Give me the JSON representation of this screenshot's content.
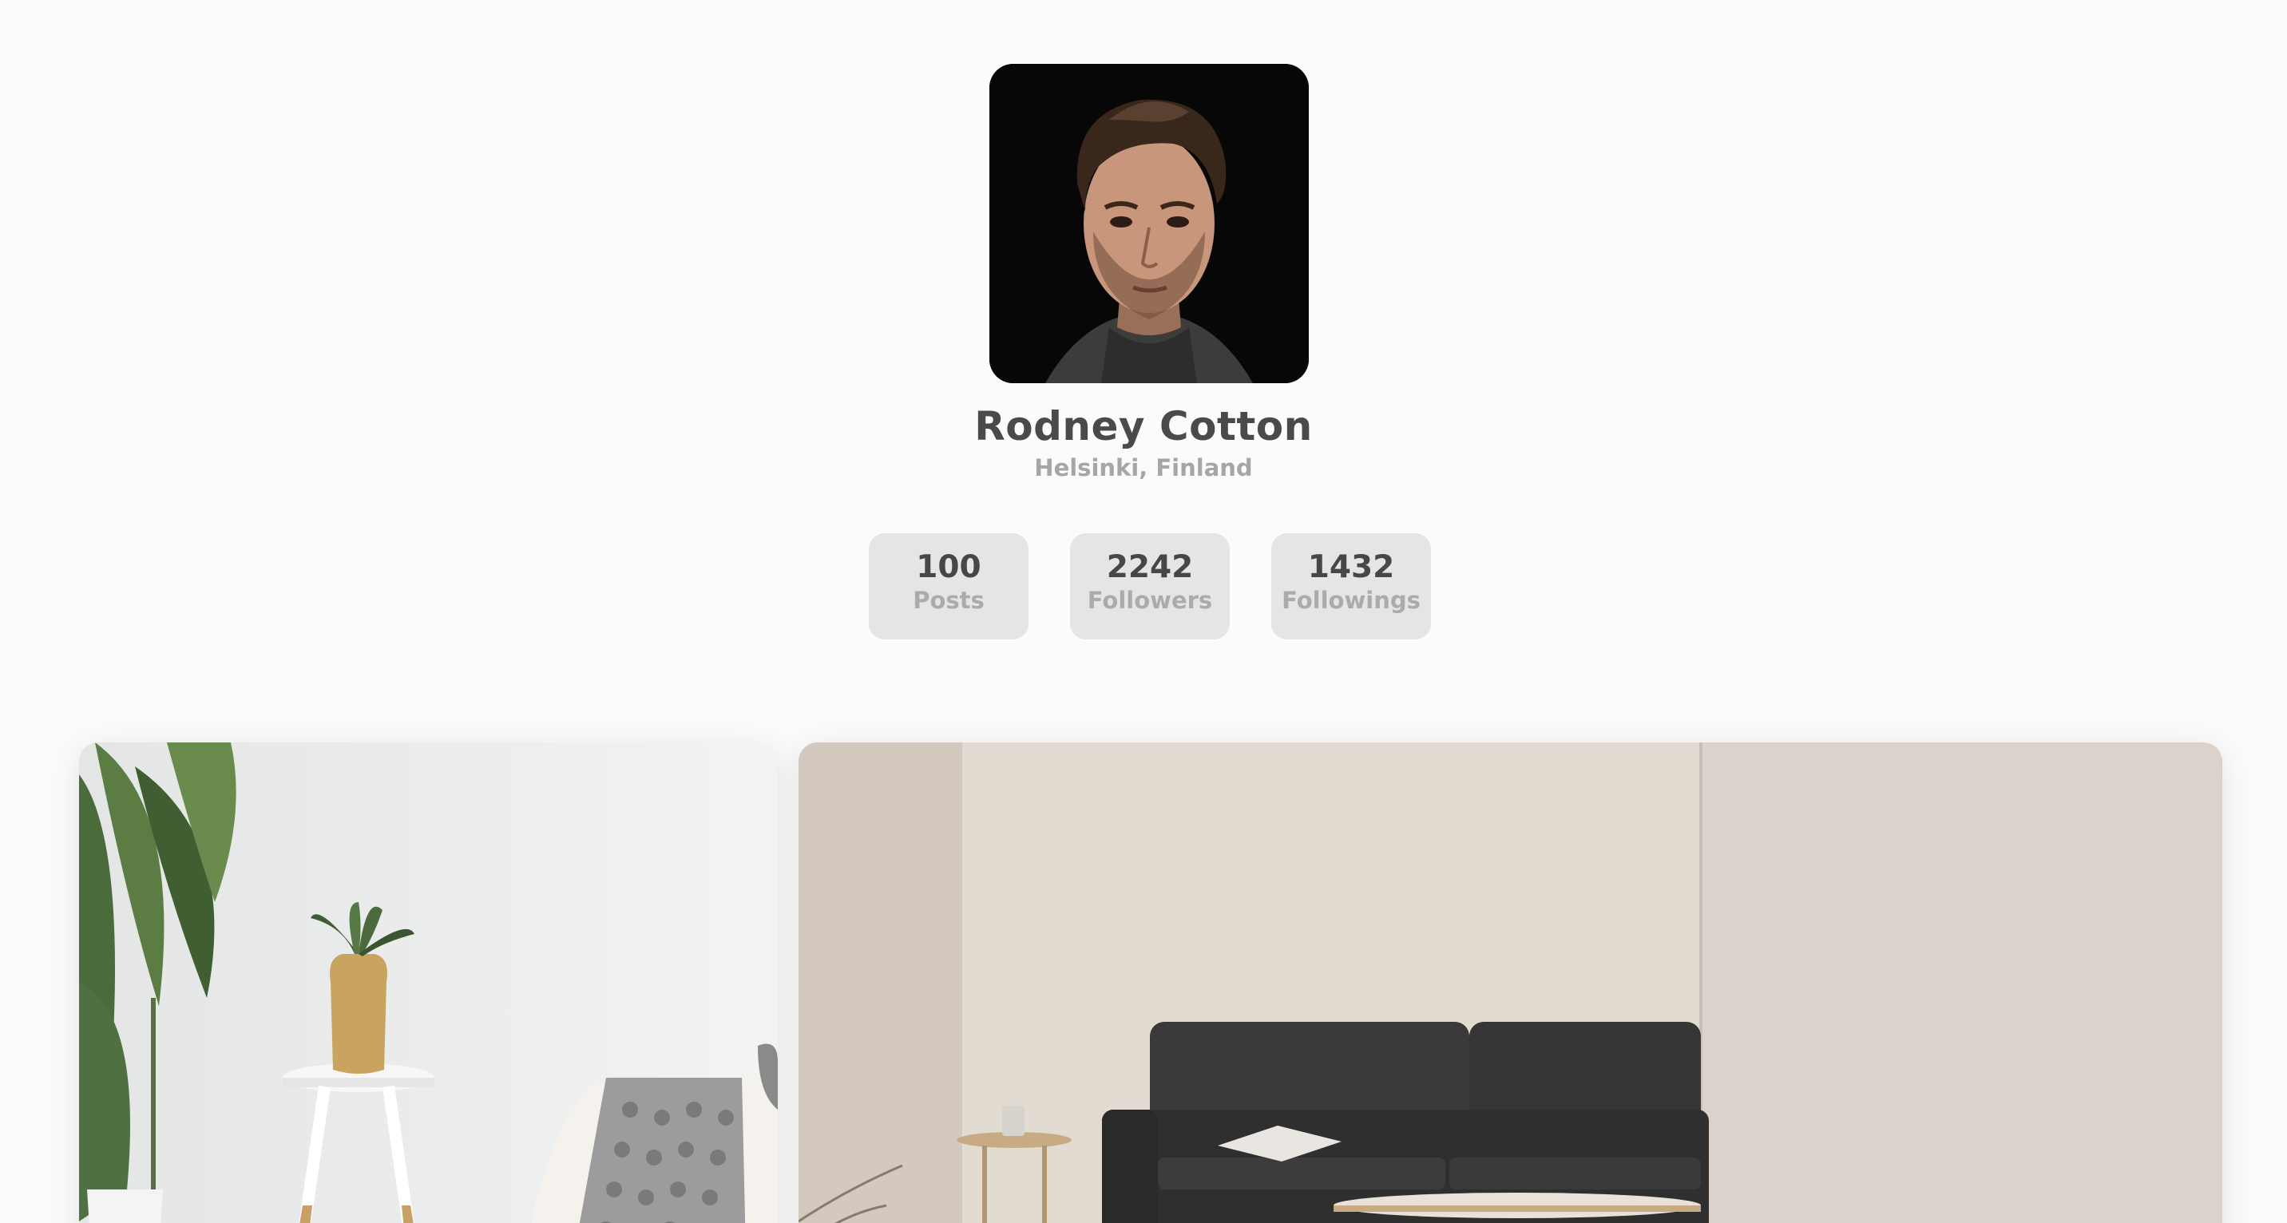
{
  "profile": {
    "name": "Rodney Cotton",
    "location": "Helsinki, Finland",
    "avatar_icon": "portrait-photo"
  },
  "stats": [
    {
      "value": "100",
      "label": "Posts"
    },
    {
      "value": "2242",
      "label": "Followers"
    },
    {
      "value": "1432",
      "label": "Followings"
    }
  ],
  "gallery": [
    {
      "icon": "living-room-plant-photo"
    },
    {
      "icon": "living-room-sofa-photo"
    }
  ],
  "colors": {
    "background": "#fbfbfb",
    "name_text": "#4a4a4a",
    "muted_text": "#a6a6a6",
    "stat_card": "#e5e5e5"
  }
}
